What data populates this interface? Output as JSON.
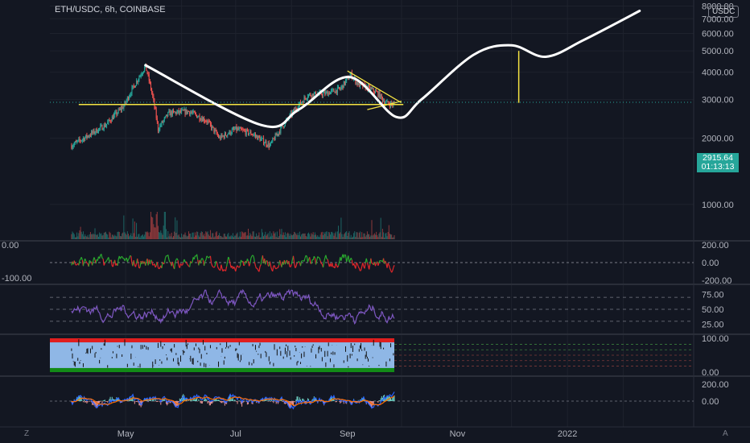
{
  "header": {
    "title": "ETH/USDC, 6h, COINBASE",
    "currency_badge": "USDC"
  },
  "last_price": {
    "value": "2915.64",
    "countdown": "01:13:13"
  },
  "corners": {
    "left": "Z",
    "right": "A"
  },
  "colors": {
    "background": "#131722",
    "grid": "#1e222d",
    "text": "#b2b5be",
    "up": "#26a69a",
    "down": "#ef5350",
    "annotation_white": "#ffffff",
    "annotation_yellow": "#f5e342",
    "rsi": "#7e57c2",
    "macd_line": "#2962ff",
    "signal_line": "#ff6d00",
    "price_tag": "#26a69a"
  },
  "chart_data": [
    {
      "type": "line",
      "name": "price",
      "x_ticks": [
        "May",
        "Jul",
        "Sep",
        "Nov",
        "2022"
      ],
      "y_ticks": [
        "1000.00",
        "2000.00",
        "3000.00",
        "4000.00",
        "5000.00",
        "6000.00",
        "7000.00",
        "8000.00"
      ],
      "y_scale": "log",
      "ylim": [
        700,
        8100
      ],
      "x": [
        "2021-04-01",
        "2021-04-10",
        "2021-04-20",
        "2021-04-30",
        "2021-05-06",
        "2021-05-12",
        "2021-05-19",
        "2021-05-25",
        "2021-06-05",
        "2021-06-15",
        "2021-06-22",
        "2021-07-01",
        "2021-07-10",
        "2021-07-20",
        "2021-07-30",
        "2021-08-10",
        "2021-08-20",
        "2021-08-28",
        "2021-09-03",
        "2021-09-07",
        "2021-09-12",
        "2021-09-18",
        "2021-09-22",
        "2021-09-27"
      ],
      "values": [
        1850,
        2050,
        2300,
        2800,
        3500,
        4250,
        2200,
        2600,
        2650,
        2400,
        2000,
        2200,
        2100,
        1850,
        2450,
        3150,
        3200,
        3350,
        3900,
        3500,
        3400,
        3200,
        2900,
        2850
      ],
      "volume_panel": {
        "profile": "high-spike around mid-May"
      },
      "annotations": {
        "support_line_price": 2850,
        "projected_path": [
          {
            "x": "2021-05-12",
            "y": 4300
          },
          {
            "x": "2021-07-15",
            "y": 2300
          },
          {
            "x": "2021-08-05",
            "y": 2700
          },
          {
            "x": "2021-09-02",
            "y": 3800
          },
          {
            "x": "2021-09-28",
            "y": 2500
          },
          {
            "x": "2021-10-12",
            "y": 3000
          },
          {
            "x": "2021-11-10",
            "y": 4800
          },
          {
            "x": "2021-12-01",
            "y": 5300
          },
          {
            "x": "2021-12-20",
            "y": 4700
          },
          {
            "x": "2022-01-10",
            "y": 5600
          },
          {
            "x": "2022-02-10",
            "y": 7600
          }
        ],
        "yellow_vertical": {
          "x": "2021-12-05",
          "from": 2900,
          "to": 5000
        },
        "triangle": {
          "upper": [
            {
              "x": "2021-09-01",
              "y": 4050
            },
            {
              "x": "2021-10-01",
              "y": 2900
            }
          ],
          "lower": [
            {
              "x": "2021-09-12",
              "y": 2700
            },
            {
              "x": "2021-10-01",
              "y": 2950
            }
          ]
        }
      }
    },
    {
      "type": "line",
      "name": "oscillator-1",
      "y_ticks": [
        "200.00",
        "0.00",
        "-200.00"
      ],
      "left_labels": [
        "0.00",
        "-100.00"
      ],
      "ylim": [
        -200,
        200
      ]
    },
    {
      "type": "line",
      "name": "rsi",
      "y_ticks": [
        "75.00",
        "50.00",
        "25.00"
      ],
      "ylim": [
        15,
        85
      ],
      "bands": [
        30,
        50,
        70
      ]
    },
    {
      "type": "area",
      "name": "stochastic",
      "y_ticks": [
        "100.00",
        "0.00"
      ],
      "ylim": [
        0,
        100
      ]
    },
    {
      "type": "line",
      "name": "macd",
      "y_ticks": [
        "200.00",
        "0.00"
      ],
      "ylim": [
        -250,
        250
      ]
    }
  ]
}
